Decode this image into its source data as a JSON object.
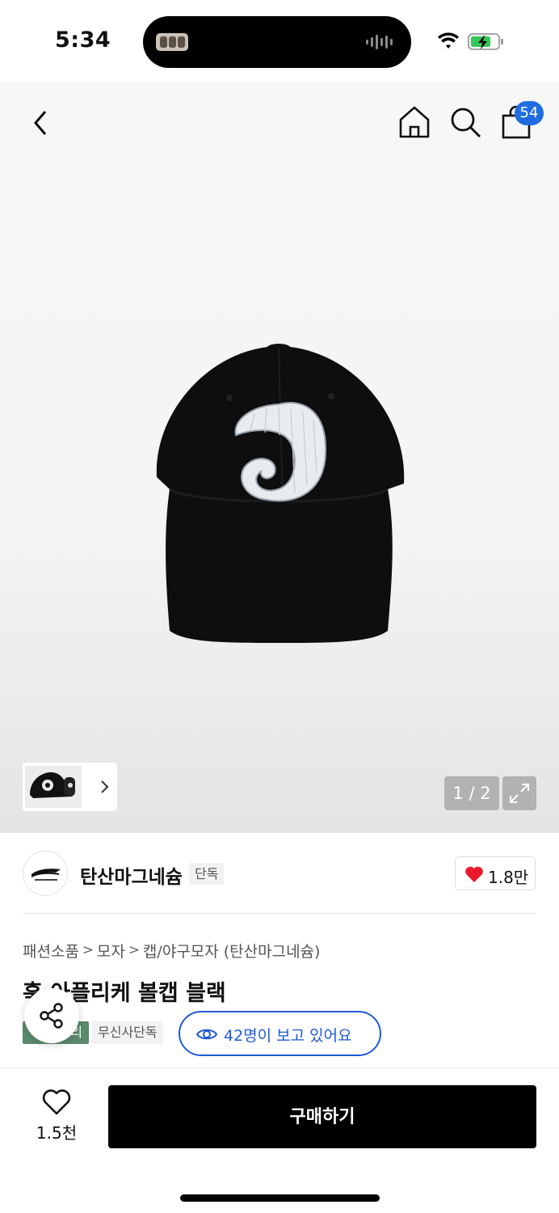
{
  "status_bar": {
    "time": "5:34"
  },
  "nav": {
    "back_icon": "chevron-left-icon",
    "home_icon": "home-icon",
    "search_icon": "search-icon",
    "bag_icon": "shopping-bag-icon",
    "cart_count": "54"
  },
  "gallery": {
    "pager": "1 / 2",
    "expand_icon": "expand-icon"
  },
  "brand": {
    "name": "탄산마그네슘",
    "exclusive_tag": "단독",
    "like_count": "1.8만",
    "like_color": "#e8192c"
  },
  "breadcrumb": [
    "패션소품",
    "모자",
    "캡/야구모자 (탄산마그네슘)"
  ],
  "product": {
    "title": "훅 아플리케 볼캡 블랙",
    "tag_gray": "무신사단독",
    "viewers_text": "42명이 보고 있어요"
  },
  "bottom": {
    "wish_count": "1.5천",
    "buy_label": "구매하기"
  },
  "colors": {
    "accent_blue": "#1f5bd6",
    "badge_blue": "#1f6de0",
    "tag_green": "#5b8a6c"
  }
}
